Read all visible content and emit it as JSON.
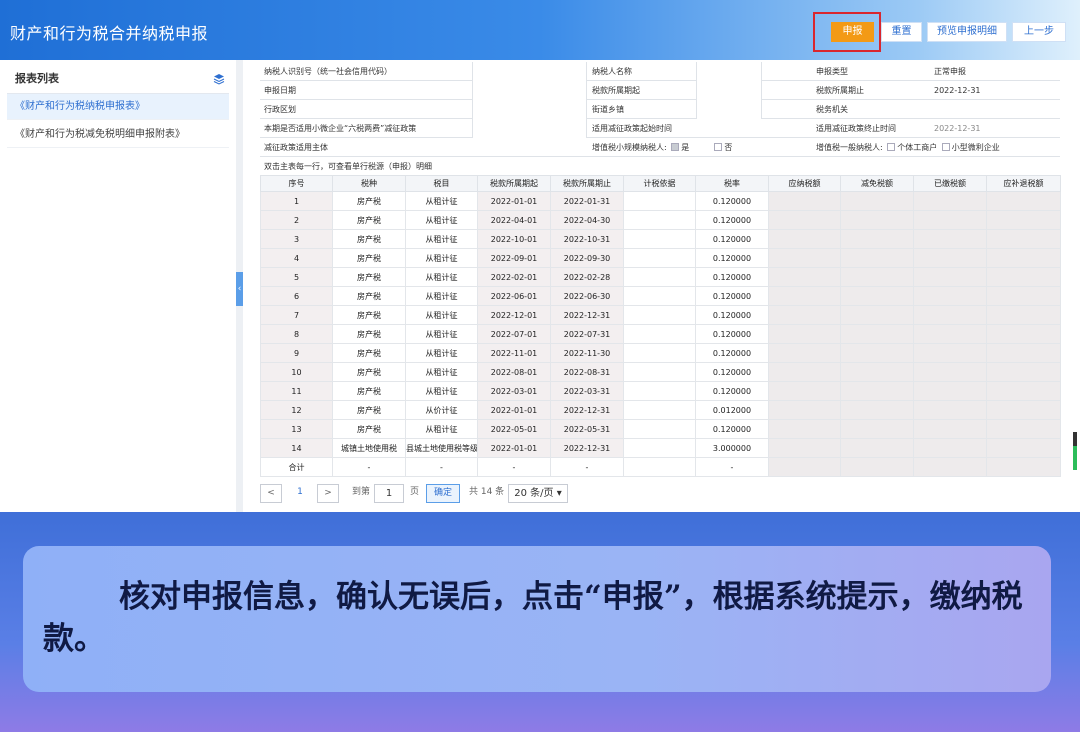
{
  "header": {
    "title": "财产和行为税合并纳税申报",
    "buttons": {
      "submit": "申报",
      "reset": "重置",
      "preview": "预览申报明细",
      "back": "上一步"
    }
  },
  "sidebar": {
    "title": "报表列表",
    "items": [
      "《财产和行为税纳税申报表》",
      "《财产和行为税减免税明细申报附表》"
    ]
  },
  "info": {
    "taxpayer_id_label": "纳税人识别号（统一社会信用代码）",
    "taxpayer_name_label": "纳税人名称",
    "declare_type_label": "申报类型",
    "declare_type_value": "正常申报",
    "declare_date_label": "申报日期",
    "period_start_label": "税款所属期起",
    "period_end_label": "税款所属期止",
    "period_end_value": "2022-12-31",
    "region_label": "行政区划",
    "street_label": "街道乡镇",
    "tax_office_label": "税务机关",
    "policy_label": "本期是否适用小微企业“六税两费”减征政策",
    "policy_start_label": "适用减征政策起始时间",
    "policy_end_label": "适用减征政策终止时间",
    "policy_end_value": "2022-12-31",
    "subject_label": "减征政策适用主体",
    "small_scale_label": "增值税小规模纳税人:",
    "yes_label": "是",
    "no_label": "否",
    "general_label": "增值税一般纳税人:",
    "individual_label": "个体工商户",
    "micro_label": "小型微利企业",
    "hint": "双击主表每一行，可查看单行税源（申报）明细"
  },
  "table": {
    "headers": [
      "序号",
      "税种",
      "税目",
      "税款所属期起",
      "税款所属期止",
      "计税依据",
      "税率",
      "应纳税额",
      "减免税额",
      "已缴税额",
      "应补退税额"
    ],
    "rows": [
      [
        "1",
        "房产税",
        "从租计征",
        "2022-01-01",
        "2022-01-31",
        "0.120000"
      ],
      [
        "2",
        "房产税",
        "从租计征",
        "2022-04-01",
        "2022-04-30",
        "0.120000"
      ],
      [
        "3",
        "房产税",
        "从租计征",
        "2022-10-01",
        "2022-10-31",
        "0.120000"
      ],
      [
        "4",
        "房产税",
        "从租计征",
        "2022-09-01",
        "2022-09-30",
        "0.120000"
      ],
      [
        "5",
        "房产税",
        "从租计征",
        "2022-02-01",
        "2022-02-28",
        "0.120000"
      ],
      [
        "6",
        "房产税",
        "从租计征",
        "2022-06-01",
        "2022-06-30",
        "0.120000"
      ],
      [
        "7",
        "房产税",
        "从租计征",
        "2022-12-01",
        "2022-12-31",
        "0.120000"
      ],
      [
        "8",
        "房产税",
        "从租计征",
        "2022-07-01",
        "2022-07-31",
        "0.120000"
      ],
      [
        "9",
        "房产税",
        "从租计征",
        "2022-11-01",
        "2022-11-30",
        "0.120000"
      ],
      [
        "10",
        "房产税",
        "从租计征",
        "2022-08-01",
        "2022-08-31",
        "0.120000"
      ],
      [
        "11",
        "房产税",
        "从租计征",
        "2022-03-01",
        "2022-03-31",
        "0.120000"
      ],
      [
        "12",
        "房产税",
        "从价计征",
        "2022-01-01",
        "2022-12-31",
        "0.012000"
      ],
      [
        "13",
        "房产税",
        "从租计征",
        "2022-05-01",
        "2022-05-31",
        "0.120000"
      ],
      [
        "14",
        "城镇土地使用税",
        "县城土地使用税等级",
        "2022-01-01",
        "2022-12-31",
        "3.000000"
      ]
    ],
    "total": [
      "合计",
      "-",
      "-",
      "-",
      "-",
      "",
      "-"
    ]
  },
  "pager": {
    "prev": "<",
    "page": "1",
    "next": ">",
    "goto": "到第",
    "goto_value": "1",
    "page_unit": "页",
    "confirm": "确定",
    "total": "共 14 条",
    "size": "20 条/页 ▾"
  },
  "caption": "核对申报信息，确认无误后，点击“申报”，根据系统提示，缴纳税款。"
}
